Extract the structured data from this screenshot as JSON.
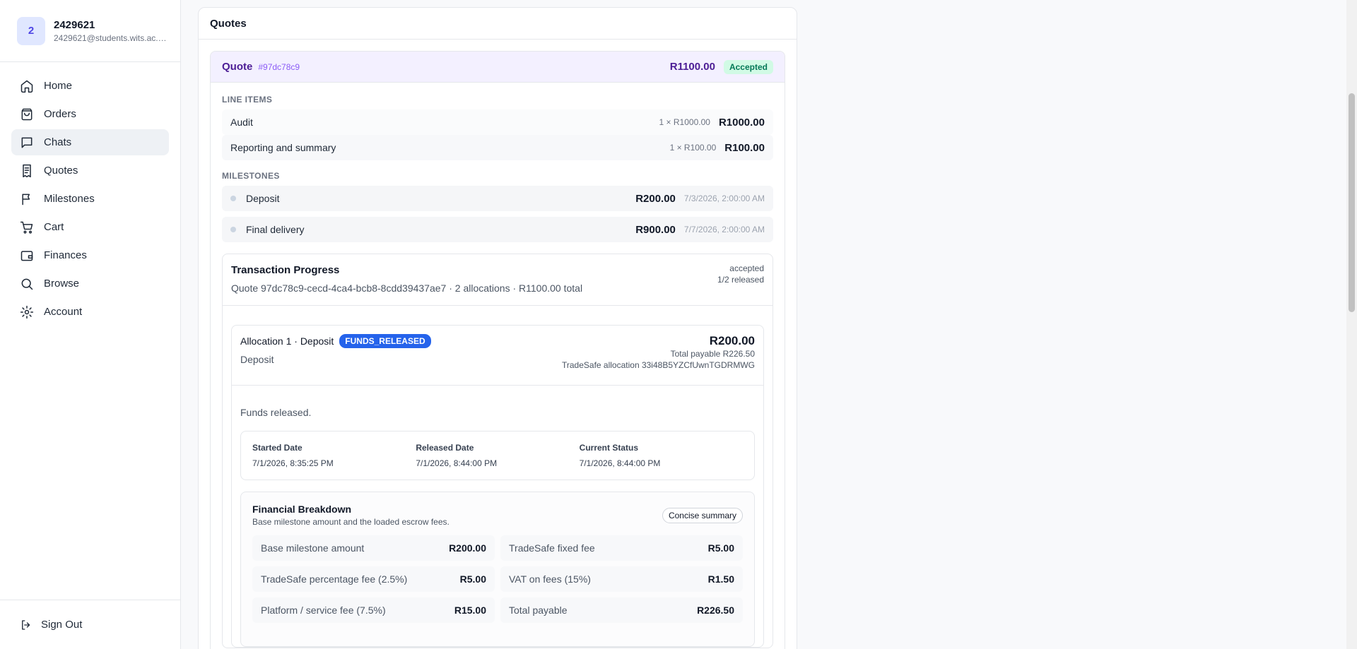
{
  "user": {
    "avatar": "2",
    "name": "2429621",
    "email": "2429621@students.wits.ac.za"
  },
  "nav": [
    {
      "label": "Home",
      "icon": "home-icon"
    },
    {
      "label": "Orders",
      "icon": "shopping-bag-icon"
    },
    {
      "label": "Chats",
      "icon": "chat-icon"
    },
    {
      "label": "Quotes",
      "icon": "receipt-icon"
    },
    {
      "label": "Milestones",
      "icon": "flag-icon"
    },
    {
      "label": "Cart",
      "icon": "cart-icon"
    },
    {
      "label": "Finances",
      "icon": "wallet-icon"
    },
    {
      "label": "Browse",
      "icon": "search-icon"
    },
    {
      "label": "Account",
      "icon": "gear-icon"
    }
  ],
  "signout": "Sign Out",
  "panel_title": "Quotes",
  "quote": {
    "label": "Quote",
    "id": "#97dc78c9",
    "total": "R1100.00",
    "status": "Accepted",
    "line_items_label": "LINE ITEMS",
    "line_items": [
      {
        "name": "Audit",
        "qty": "1 × R1000.00",
        "amount": "R1000.00"
      },
      {
        "name": "Reporting and summary",
        "qty": "1 × R100.00",
        "amount": "R100.00"
      }
    ],
    "milestones_label": "MILESTONES",
    "milestones": [
      {
        "name": "Deposit",
        "amount": "R200.00",
        "date": "7/3/2026, 2:00:00 AM"
      },
      {
        "name": "Final delivery",
        "amount": "R900.00",
        "date": "7/7/2026, 2:00:00 AM"
      }
    ]
  },
  "transaction": {
    "title": "Transaction Progress",
    "subtitle": "Quote 97dc78c9-cecd-4ca4-bcb8-8cdd39437ae7 · 2 allocations · R1100.00 total",
    "status": "accepted",
    "released": "1/2 released",
    "allocation": {
      "title": "Allocation 1 · Deposit",
      "badge": "FUNDS_RELEASED",
      "subtitle": "Deposit",
      "amount": "R200.00",
      "total_payable": "Total payable R226.50",
      "tradesafe_ref": "TradeSafe allocation 33i48B5YZCfUwnTGDRMWG",
      "message": "Funds released.",
      "dates": [
        {
          "label": "Started Date",
          "value": "7/1/2026, 8:35:25 PM"
        },
        {
          "label": "Released Date",
          "value": "7/1/2026, 8:44:00 PM"
        },
        {
          "label": "Current Status",
          "value": "7/1/2026, 8:44:00 PM"
        }
      ],
      "breakdown": {
        "title": "Financial Breakdown",
        "subtitle": "Base milestone amount and the loaded escrow fees.",
        "button": "Concise summary",
        "rows": [
          {
            "label": "Base milestone amount",
            "value": "R200.00"
          },
          {
            "label": "TradeSafe fixed fee",
            "value": "R5.00"
          },
          {
            "label": "TradeSafe percentage fee (2.5%)",
            "value": "R5.00"
          },
          {
            "label": "VAT on fees (15%)",
            "value": "R1.50"
          },
          {
            "label": "Platform / service fee (7.5%)",
            "value": "R15.00"
          },
          {
            "label": "Total payable",
            "value": "R226.50"
          }
        ]
      }
    }
  },
  "colors": {
    "accent": "#4c1d95",
    "success_bg": "#d1fae5",
    "badge_blue": "#2563eb"
  }
}
